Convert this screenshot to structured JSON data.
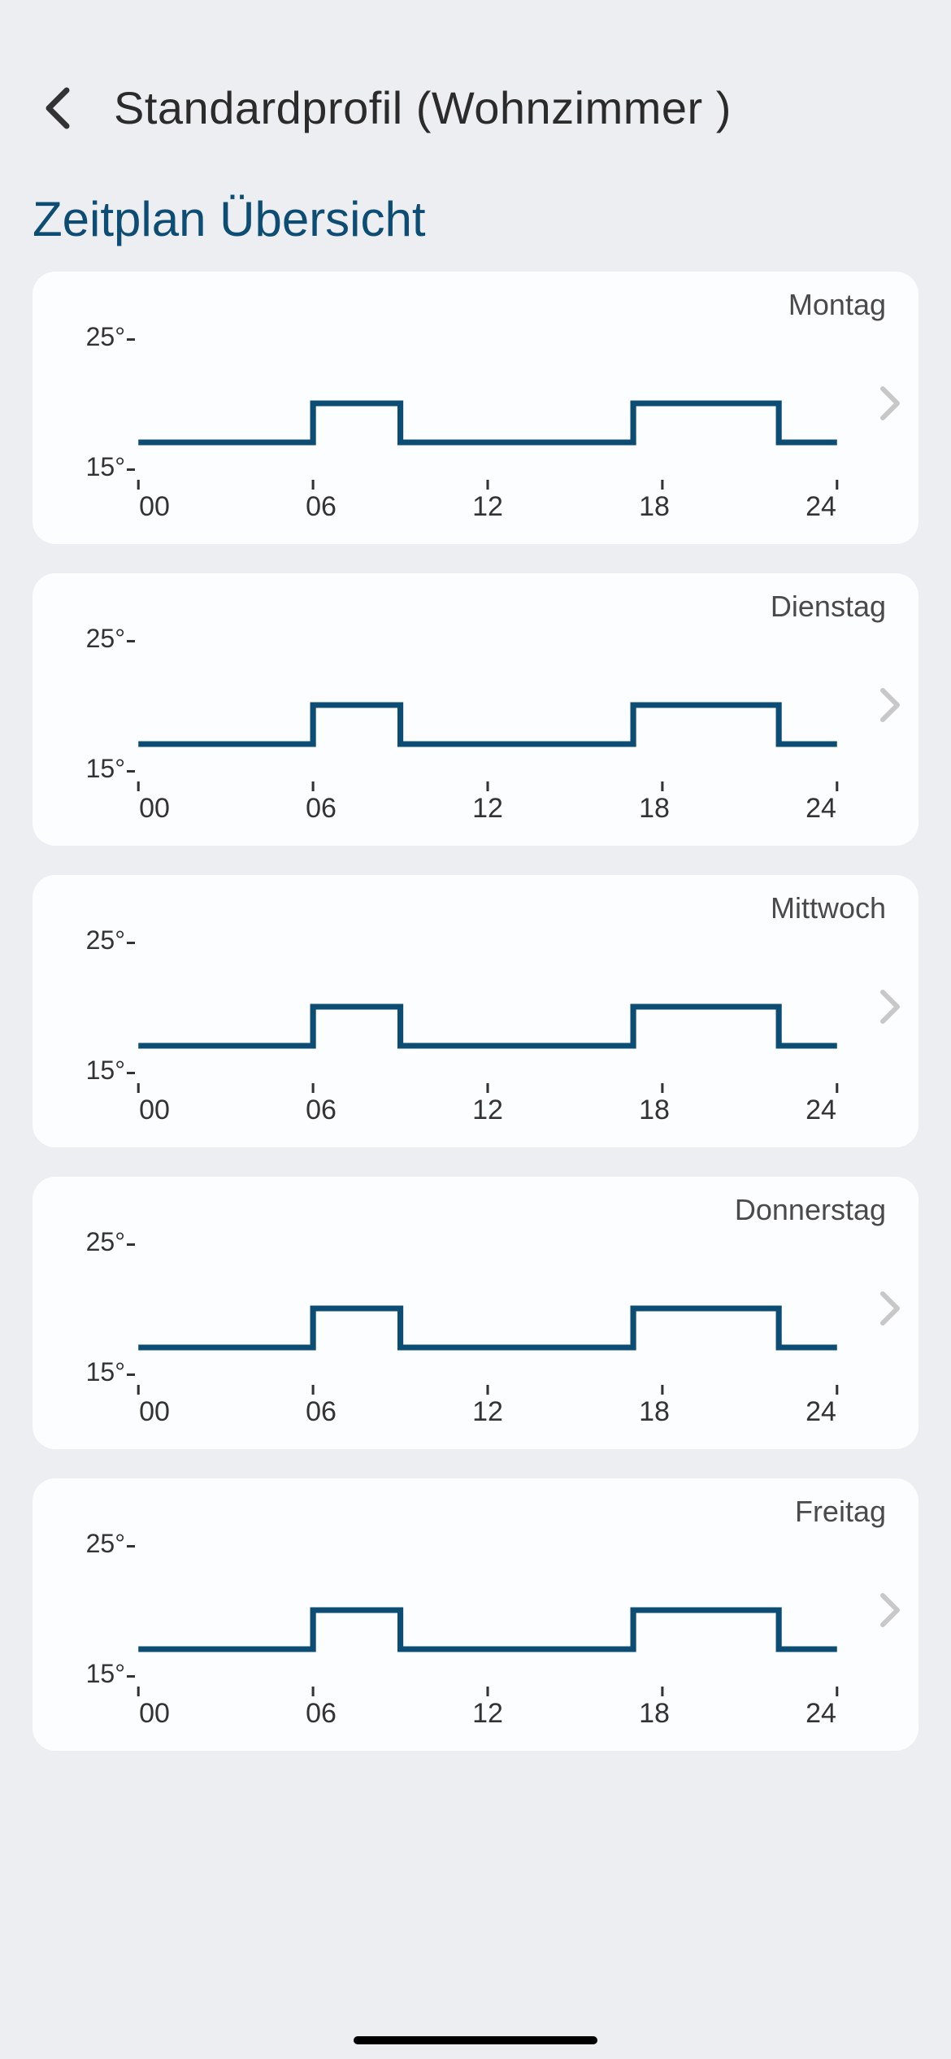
{
  "header": {
    "title": "Standardprofil (Wohnzimmer )"
  },
  "section_title": "Zeitplan Übersicht",
  "y_axis": {
    "top_label": "25°",
    "bottom_label": "15°"
  },
  "x_ticks": [
    "00",
    "06",
    "12",
    "18",
    "24"
  ],
  "days": [
    {
      "name": "Montag"
    },
    {
      "name": "Dienstag"
    },
    {
      "name": "Mittwoch"
    },
    {
      "name": "Donnerstag"
    },
    {
      "name": "Freitag"
    }
  ],
  "chart_data": [
    {
      "type": "line",
      "title": "Montag",
      "xlabel": "",
      "ylabel": "°",
      "ylim": [
        15,
        25
      ],
      "x_ticks": [
        "00",
        "06",
        "12",
        "18",
        "24"
      ],
      "y_ticks": [
        15,
        25
      ],
      "x": [
        0,
        6,
        6,
        9,
        9,
        17,
        17,
        22,
        22,
        24
      ],
      "y": [
        17,
        17,
        20,
        20,
        17,
        17,
        20,
        20,
        17,
        17
      ]
    },
    {
      "type": "line",
      "title": "Dienstag",
      "xlabel": "",
      "ylabel": "°",
      "ylim": [
        15,
        25
      ],
      "x_ticks": [
        "00",
        "06",
        "12",
        "18",
        "24"
      ],
      "y_ticks": [
        15,
        25
      ],
      "x": [
        0,
        6,
        6,
        9,
        9,
        17,
        17,
        22,
        22,
        24
      ],
      "y": [
        17,
        17,
        20,
        20,
        17,
        17,
        20,
        20,
        17,
        17
      ]
    },
    {
      "type": "line",
      "title": "Mittwoch",
      "xlabel": "",
      "ylabel": "°",
      "ylim": [
        15,
        25
      ],
      "x_ticks": [
        "00",
        "06",
        "12",
        "18",
        "24"
      ],
      "y_ticks": [
        15,
        25
      ],
      "x": [
        0,
        6,
        6,
        9,
        9,
        17,
        17,
        22,
        22,
        24
      ],
      "y": [
        17,
        17,
        20,
        20,
        17,
        17,
        20,
        20,
        17,
        17
      ]
    },
    {
      "type": "line",
      "title": "Donnerstag",
      "xlabel": "",
      "ylabel": "°",
      "ylim": [
        15,
        25
      ],
      "x_ticks": [
        "00",
        "06",
        "12",
        "18",
        "24"
      ],
      "y_ticks": [
        15,
        25
      ],
      "x": [
        0,
        6,
        6,
        9,
        9,
        17,
        17,
        22,
        22,
        24
      ],
      "y": [
        17,
        17,
        20,
        20,
        17,
        17,
        20,
        20,
        17,
        17
      ]
    },
    {
      "type": "line",
      "title": "Freitag",
      "xlabel": "",
      "ylabel": "°",
      "ylim": [
        15,
        25
      ],
      "x_ticks": [
        "00",
        "06",
        "12",
        "18",
        "24"
      ],
      "y_ticks": [
        15,
        25
      ],
      "x": [
        0,
        6,
        6,
        9,
        9,
        17,
        17,
        22,
        22,
        24
      ],
      "y": [
        17,
        17,
        20,
        20,
        17,
        17,
        20,
        20,
        17,
        17
      ]
    }
  ],
  "colors": {
    "line": "#0e4d73"
  }
}
